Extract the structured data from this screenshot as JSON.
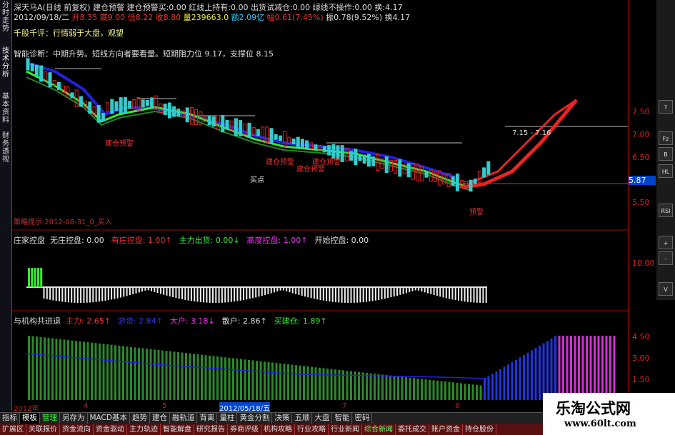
{
  "left_tabs": [
    "分时走势",
    "技术分析",
    "基本资料",
    "财务透视"
  ],
  "header": {
    "line1": "深天马A(日线 前复权) 建仓预警 建仓预警买:0.00 红线上持有:0.00 出货试减仓:0.00 绿线不操作:0.00 换:4.17",
    "line2_date": "2012/09/18/二",
    "line2_open": "开8.35",
    "line2_high": "高9.00",
    "line2_low": "低8.22",
    "line2_close": "收8.80",
    "line2_vol": "量239663.0",
    "line2_amt": "额2.09亿",
    "line2_chg": "幅0.61(7.45%)",
    "line2_amp": "振0.78(9.52%)",
    "line2_turn": "换4.17",
    "comment": "千股千评：行情弱于大盘，观望",
    "diagnosis": "智能诊断：中期升势。短线方向者要看量。短期阻力位 9.17，支撑位 8.15",
    "signal_text": "策略提示:2012-08-31_0_买入"
  },
  "main_annotations": [
    "建仓预警",
    "建仓预警",
    "建仓预警",
    "建仓预警",
    "买点",
    "预警",
    "7.15 - 7.16"
  ],
  "price_ticks": [
    "7.50",
    "7.00",
    "6.50",
    "6.00",
    "5.87",
    "5.50"
  ],
  "panel2": {
    "title": "庄家控盘",
    "items": [
      {
        "label": "无庄控盘:",
        "value": "0.00",
        "color": "#dddddd"
      },
      {
        "label": "有庄控盘:",
        "value": "1.00↑",
        "color": "#ee3333"
      },
      {
        "label": "主力出货:",
        "value": "0.00↓",
        "color": "#33ee33"
      },
      {
        "label": "高度控盘:",
        "value": "1.00↑",
        "color": "#ee33ee"
      },
      {
        "label": "开始控盘:",
        "value": "0.00",
        "color": "#dddddd"
      }
    ],
    "tick": "10.00"
  },
  "panel3": {
    "title": "与机构共进退",
    "items": [
      {
        "label": "主力:",
        "value": "2.65↑",
        "color": "#ee3333"
      },
      {
        "label": "游资:",
        "value": "2.84↑",
        "color": "#3333ee"
      },
      {
        "label": "大户:",
        "value": "3.18↓",
        "color": "#ee33ee"
      },
      {
        "label": "散户:",
        "value": "2.86↑",
        "color": "#dddddd"
      },
      {
        "label": "买建仓:",
        "value": "1.89↑",
        "color": "#33ee33"
      }
    ],
    "ticks": [
      "4.50",
      "3.00",
      "1.50"
    ]
  },
  "dates": [
    "2012年",
    "4",
    "5",
    "2012/05/18/五",
    "7",
    "8"
  ],
  "toolbar_buttons": [
    "?",
    "Fz",
    "B",
    "HL",
    "RSI",
    "+",
    "-",
    "V"
  ],
  "bottom_tabs1": [
    {
      "label": "指标",
      "state": "normal"
    },
    {
      "label": "模板",
      "state": "sel"
    },
    {
      "label": "管理",
      "state": "green"
    },
    {
      "label": "另存为",
      "state": "normal"
    },
    {
      "label": "MACD基本",
      "state": "normal"
    },
    {
      "label": "趋势",
      "state": "normal"
    },
    {
      "label": "建仓",
      "state": "normal"
    },
    {
      "label": "融轨道",
      "state": "normal"
    },
    {
      "label": "背离",
      "state": "normal"
    },
    {
      "label": "量柱",
      "state": "normal"
    },
    {
      "label": "黄金分割",
      "state": "normal"
    },
    {
      "label": "决策",
      "state": "normal"
    },
    {
      "label": "五顺",
      "state": "normal"
    },
    {
      "label": "大盘",
      "state": "normal"
    },
    {
      "label": "智能",
      "state": "normal"
    },
    {
      "label": "密码",
      "state": "normal"
    }
  ],
  "bottom_tabs2": [
    {
      "label": "扩展区",
      "hl": false
    },
    {
      "label": "关联报价",
      "hl": false
    },
    {
      "label": "资金流向",
      "hl": false
    },
    {
      "label": "资金驱动",
      "hl": false
    },
    {
      "label": "主力轨迹",
      "hl": false
    },
    {
      "label": "智能解盘",
      "hl": false
    },
    {
      "label": "研究报告",
      "hl": false
    },
    {
      "label": "券商评级",
      "hl": false
    },
    {
      "label": "机构攻略",
      "hl": false
    },
    {
      "label": "行业攻略",
      "hl": false
    },
    {
      "label": "行业新闻",
      "hl": false
    },
    {
      "label": "综合新闻",
      "hl": true
    },
    {
      "label": "委托成交",
      "hl": false
    },
    {
      "label": "账户资金",
      "hl": false
    },
    {
      "label": "持仓股份",
      "hl": false
    }
  ],
  "watermark": {
    "title": "乐淘公式网",
    "url": "www.60lt.com"
  },
  "colors": {
    "up": "#ee2222",
    "down": "#33cccc",
    "ma_green": "#33ee33",
    "ma_blue": "#2222dd",
    "axis": "#aa0000"
  }
}
